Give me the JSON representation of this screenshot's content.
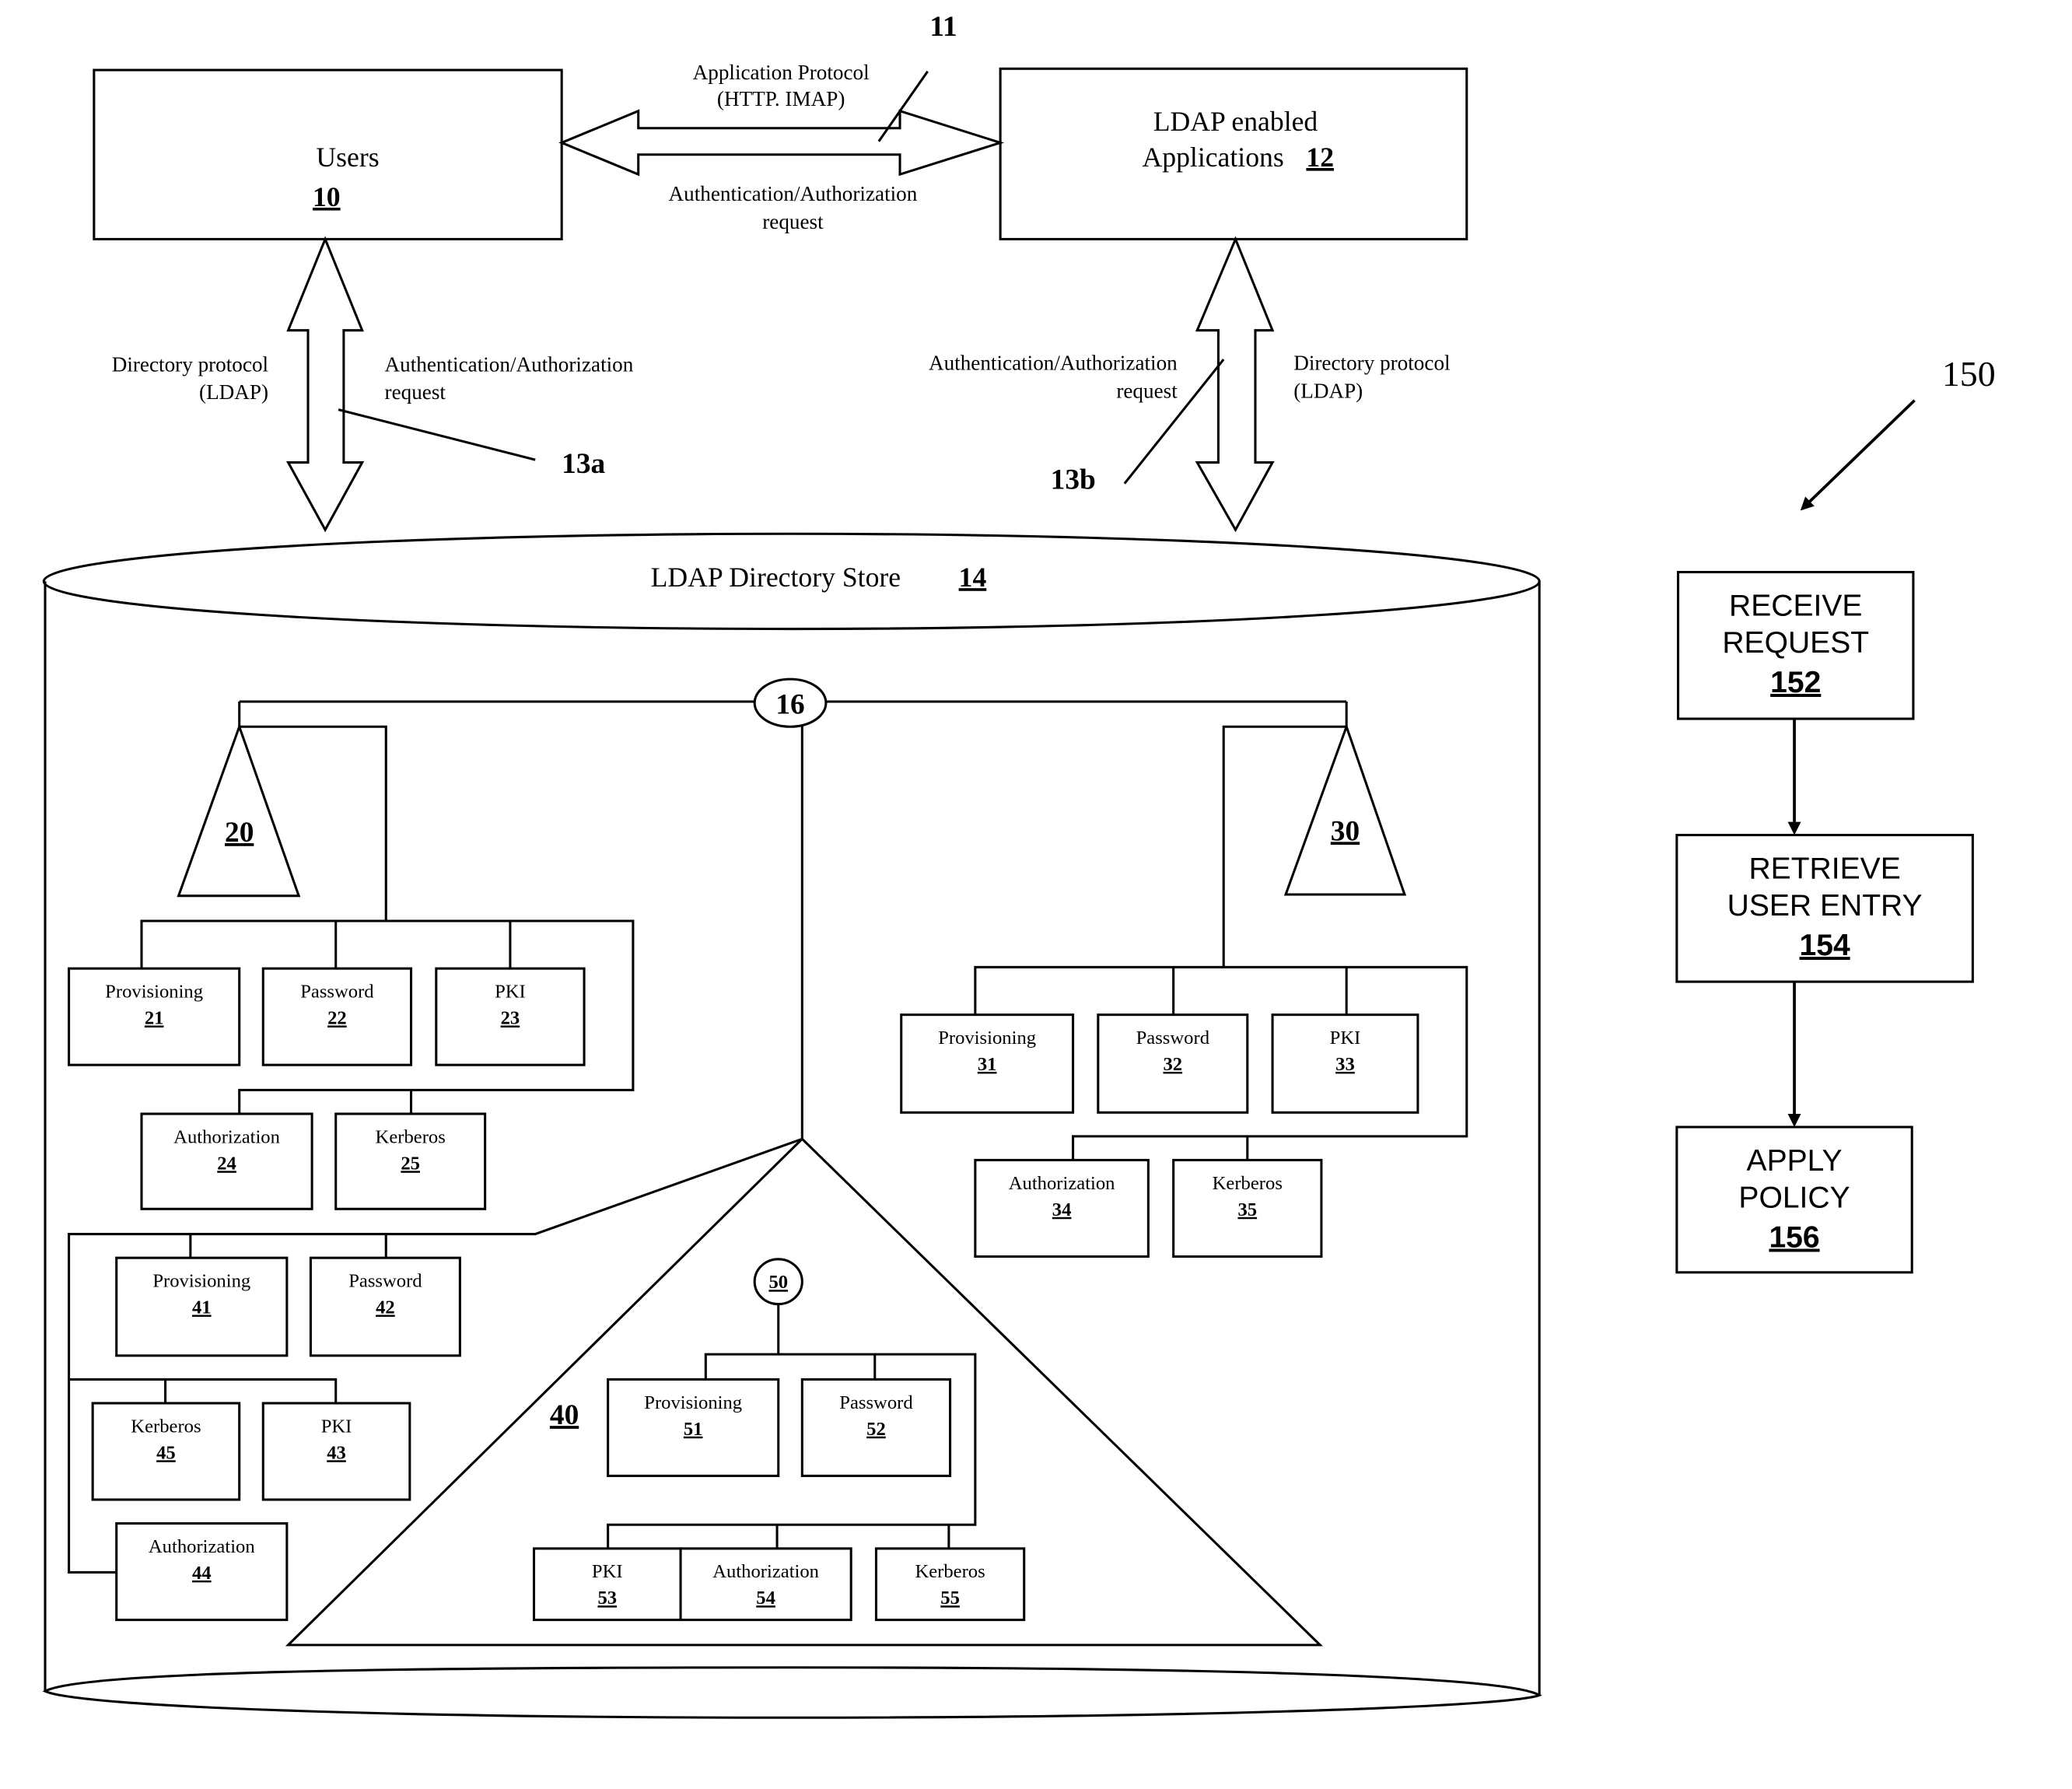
{
  "top": {
    "ref_11": "11",
    "app_protocol_line1": "Application Protocol",
    "app_protocol_line2": "(HTTP. IMAP)",
    "auth_req_line1": "Authentication/Authorization",
    "auth_req_line2": "request"
  },
  "users": {
    "label": "Users",
    "ref": "10"
  },
  "apps": {
    "line1": "LDAP enabled",
    "line2": "Applications",
    "ref": "12"
  },
  "left_link": {
    "dir_line1": "Directory protocol",
    "dir_line2": "(LDAP)",
    "auth_line1": "Authentication/Authorization",
    "auth_line2": "request",
    "ref": "13a"
  },
  "right_link": {
    "auth_line1": "Authentication/Authorization",
    "auth_line2": "request",
    "dir_line1": "Directory protocol",
    "dir_line2": "(LDAP)",
    "ref": "13b"
  },
  "store": {
    "label": "LDAP Directory Store",
    "ref": "14",
    "root_ref": "16"
  },
  "tree20": {
    "ref": "20",
    "nodes": [
      {
        "label": "Provisioning",
        "ref": "21"
      },
      {
        "label": "Password",
        "ref": "22"
      },
      {
        "label": "PKI",
        "ref": "23"
      },
      {
        "label": "Authorization",
        "ref": "24"
      },
      {
        "label": "Kerberos",
        "ref": "25"
      }
    ]
  },
  "tree30": {
    "ref": "30",
    "nodes": [
      {
        "label": "Provisioning",
        "ref": "31"
      },
      {
        "label": "Password",
        "ref": "32"
      },
      {
        "label": "PKI",
        "ref": "33"
      },
      {
        "label": "Authorization",
        "ref": "34"
      },
      {
        "label": "Kerberos",
        "ref": "35"
      }
    ]
  },
  "tree40": {
    "ref": "40",
    "nodes": [
      {
        "label": "Provisioning",
        "ref": "41"
      },
      {
        "label": "Password",
        "ref": "42"
      },
      {
        "label": "PKI",
        "ref": "43"
      },
      {
        "label": "Authorization",
        "ref": "44"
      },
      {
        "label": "Kerberos",
        "ref": "45"
      }
    ]
  },
  "tree50": {
    "ref": "50",
    "nodes": [
      {
        "label": "Provisioning",
        "ref": "51"
      },
      {
        "label": "Password",
        "ref": "52"
      },
      {
        "label": "PKI",
        "ref": "53"
      },
      {
        "label": "Authorization",
        "ref": "54"
      },
      {
        "label": "Kerberos",
        "ref": "55"
      }
    ]
  },
  "flow": {
    "ref": "150",
    "steps": [
      {
        "line1": "RECEIVE",
        "line2": "REQUEST",
        "ref": "152"
      },
      {
        "line1": "RETRIEVE",
        "line2": "USER ENTRY",
        "ref": "154"
      },
      {
        "line1": "APPLY",
        "line2": "POLICY",
        "ref": "156"
      }
    ]
  }
}
